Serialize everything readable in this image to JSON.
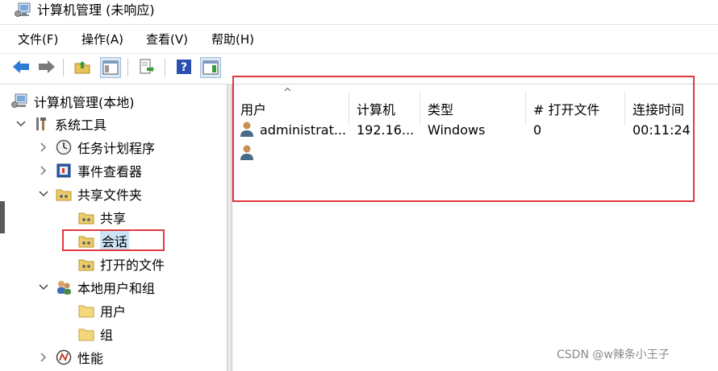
{
  "window": {
    "title": "计算机管理 (未响应)"
  },
  "menu": {
    "items": [
      "文件(F)",
      "操作(A)",
      "查看(V)",
      "帮助(H)"
    ]
  },
  "tree": {
    "root": "计算机管理(本地)",
    "system_tools": "系统工具",
    "task_scheduler": "任务计划程序",
    "event_viewer": "事件查看器",
    "shared_folders": "共享文件夹",
    "shares": "共享",
    "sessions": "会话",
    "open_files": "打开的文件",
    "local_users_groups": "本地用户和组",
    "users": "用户",
    "groups": "组",
    "performance": "性能"
  },
  "list": {
    "columns": [
      "用户",
      "计算机",
      "类型",
      "# 打开文件",
      "连接时间"
    ],
    "sort_indicator": "^",
    "rows": [
      [
        "administrat...",
        "192.16...",
        "Windows",
        "0",
        "00:11:24"
      ],
      [
        "",
        "",
        "",
        "",
        ""
      ]
    ]
  },
  "watermark": "CSDN @w辣条小王子",
  "colors": {
    "highlight_box": "#e0393e",
    "selection": "#cde4f7",
    "arrow_blue": "#2e7bd6"
  }
}
